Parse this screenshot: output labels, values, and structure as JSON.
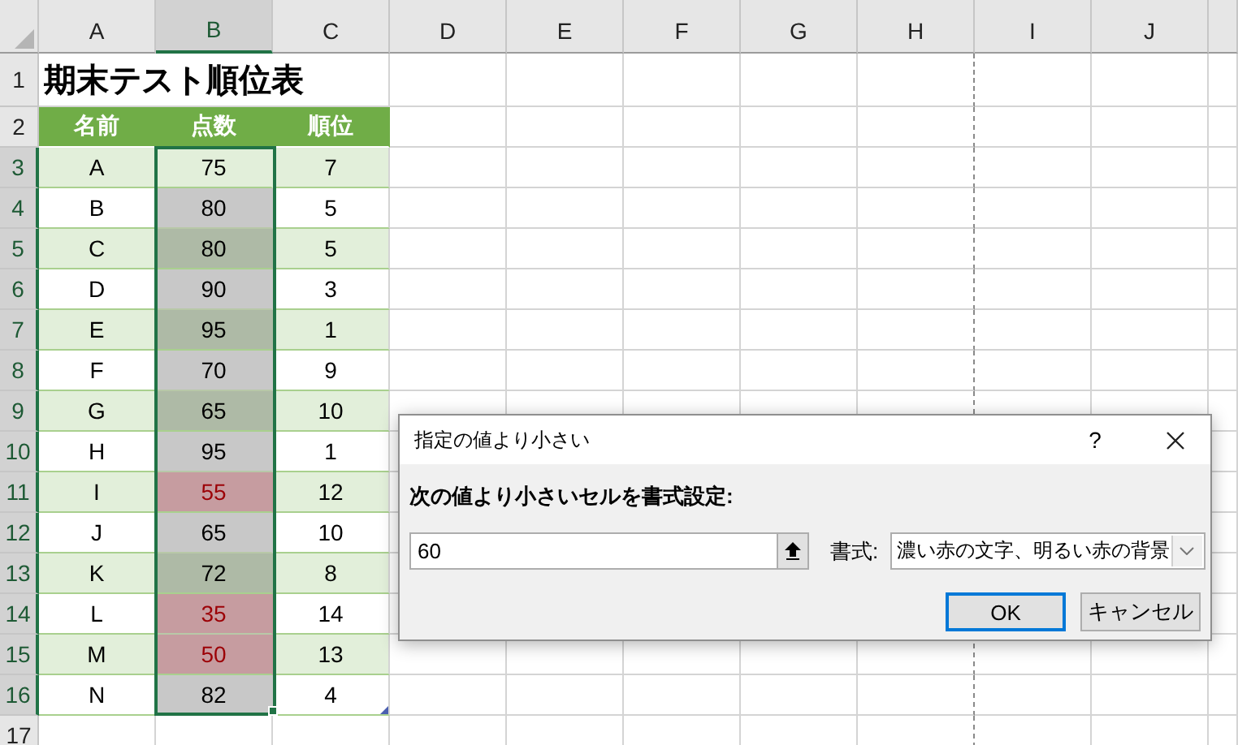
{
  "column_headers": [
    {
      "label": "A",
      "selected": false
    },
    {
      "label": "B",
      "selected": true
    },
    {
      "label": "C",
      "selected": false
    },
    {
      "label": "D",
      "selected": false
    },
    {
      "label": "E",
      "selected": false
    },
    {
      "label": "F",
      "selected": false
    },
    {
      "label": "G",
      "selected": false
    },
    {
      "label": "H",
      "selected": false
    },
    {
      "label": "I",
      "selected": false
    },
    {
      "label": "J",
      "selected": false
    }
  ],
  "row_headers": [
    {
      "label": "1",
      "selected": false
    },
    {
      "label": "2",
      "selected": false
    },
    {
      "label": "3",
      "selected": true
    },
    {
      "label": "4",
      "selected": true
    },
    {
      "label": "5",
      "selected": true
    },
    {
      "label": "6",
      "selected": true
    },
    {
      "label": "7",
      "selected": true
    },
    {
      "label": "8",
      "selected": true
    },
    {
      "label": "9",
      "selected": true
    },
    {
      "label": "10",
      "selected": true
    },
    {
      "label": "11",
      "selected": true
    },
    {
      "label": "12",
      "selected": true
    },
    {
      "label": "13",
      "selected": true
    },
    {
      "label": "14",
      "selected": true
    },
    {
      "label": "15",
      "selected": true
    },
    {
      "label": "16",
      "selected": true
    },
    {
      "label": "17",
      "selected": false
    }
  ],
  "title": "期末テスト順位表",
  "table": {
    "columns": [
      "名前",
      "点数",
      "順位"
    ],
    "rows": [
      {
        "name": "A",
        "score": "75",
        "rank": "7",
        "selected": true,
        "active": true,
        "highlighted": false
      },
      {
        "name": "B",
        "score": "80",
        "rank": "5",
        "selected": true,
        "active": false,
        "highlighted": false
      },
      {
        "name": "C",
        "score": "80",
        "rank": "5",
        "selected": true,
        "active": false,
        "highlighted": false
      },
      {
        "name": "D",
        "score": "90",
        "rank": "3",
        "selected": true,
        "active": false,
        "highlighted": false
      },
      {
        "name": "E",
        "score": "95",
        "rank": "1",
        "selected": true,
        "active": false,
        "highlighted": false
      },
      {
        "name": "F",
        "score": "70",
        "rank": "9",
        "selected": true,
        "active": false,
        "highlighted": false
      },
      {
        "name": "G",
        "score": "65",
        "rank": "10",
        "selected": true,
        "active": false,
        "highlighted": false
      },
      {
        "name": "H",
        "score": "95",
        "rank": "1",
        "selected": true,
        "active": false,
        "highlighted": false
      },
      {
        "name": "I",
        "score": "55",
        "rank": "12",
        "selected": true,
        "active": false,
        "highlighted": true
      },
      {
        "name": "J",
        "score": "65",
        "rank": "10",
        "selected": true,
        "active": false,
        "highlighted": false
      },
      {
        "name": "K",
        "score": "72",
        "rank": "8",
        "selected": true,
        "active": false,
        "highlighted": false
      },
      {
        "name": "L",
        "score": "35",
        "rank": "14",
        "selected": true,
        "active": false,
        "highlighted": true
      },
      {
        "name": "M",
        "score": "50",
        "rank": "13",
        "selected": true,
        "active": false,
        "highlighted": true
      },
      {
        "name": "N",
        "score": "82",
        "rank": "4",
        "selected": true,
        "active": false,
        "highlighted": false
      }
    ]
  },
  "dialog": {
    "title": "指定の値より小さい",
    "help": "?",
    "prompt": "次の値より小さいセルを書式設定:",
    "value": "60",
    "format_label": "書式:",
    "format_value": "濃い赤の文字、明るい赤の背景",
    "buttons": [
      {
        "label": "OK",
        "default": true
      },
      {
        "label": "キャンセル",
        "default": false
      }
    ]
  }
}
